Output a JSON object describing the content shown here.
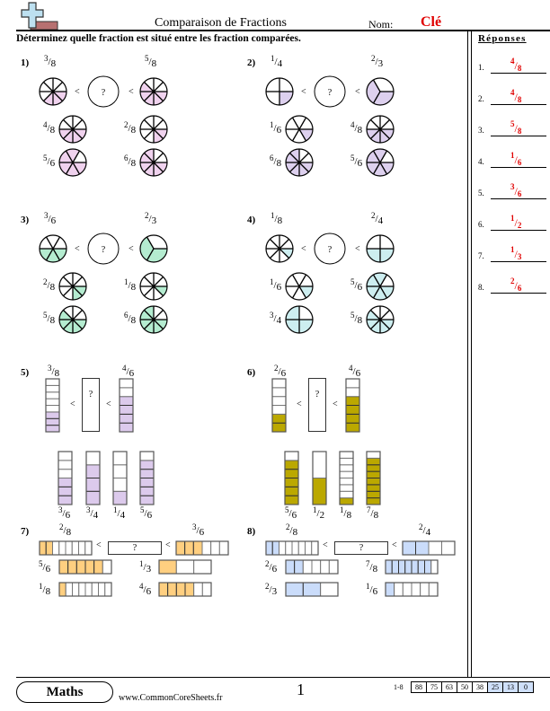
{
  "header": {
    "title": "Comparaison de Fractions",
    "name_label": "Nom:",
    "name_value": "Clé",
    "instructions": "Déterminez quelle fraction est situé entre les fraction comparées."
  },
  "answers": {
    "title": "Réponses",
    "items": [
      {
        "num": "1.",
        "n": "4",
        "d": "8"
      },
      {
        "num": "2.",
        "n": "4",
        "d": "8"
      },
      {
        "num": "3.",
        "n": "5",
        "d": "8"
      },
      {
        "num": "4.",
        "n": "1",
        "d": "6"
      },
      {
        "num": "5.",
        "n": "3",
        "d": "6"
      },
      {
        "num": "6.",
        "n": "1",
        "d": "2"
      },
      {
        "num": "7.",
        "n": "1",
        "d": "3"
      },
      {
        "num": "8.",
        "n": "2",
        "d": "6"
      }
    ]
  },
  "symbols": {
    "less_than": "<",
    "unknown": "?"
  },
  "problems": [
    {
      "label": "1)",
      "type": "circle",
      "color": "#f0d2ee",
      "left": [
        3,
        8
      ],
      "right": [
        5,
        8
      ],
      "options": [
        [
          4,
          8
        ],
        [
          2,
          8
        ],
        [
          5,
          6
        ],
        [
          6,
          8
        ]
      ]
    },
    {
      "label": "2)",
      "type": "circle",
      "color": "#ddd0ee",
      "left": [
        1,
        4
      ],
      "right": [
        2,
        3
      ],
      "options": [
        [
          1,
          6
        ],
        [
          4,
          8
        ],
        [
          6,
          8
        ],
        [
          5,
          6
        ]
      ]
    },
    {
      "label": "3)",
      "type": "circle",
      "color": "#b4ecd0",
      "left": [
        3,
        6
      ],
      "right": [
        2,
        3
      ],
      "options": [
        [
          2,
          8
        ],
        [
          1,
          8
        ],
        [
          5,
          8
        ],
        [
          6,
          8
        ]
      ]
    },
    {
      "label": "4)",
      "type": "circle",
      "color": "#cdeef0",
      "left": [
        1,
        8
      ],
      "right": [
        2,
        4
      ],
      "options": [
        [
          1,
          6
        ],
        [
          5,
          6
        ],
        [
          3,
          4
        ],
        [
          5,
          8
        ]
      ]
    },
    {
      "label": "5)",
      "type": "vbar",
      "color": "#dccaec",
      "left": [
        3,
        8
      ],
      "right": [
        4,
        6
      ],
      "options": [
        [
          3,
          6
        ],
        [
          3,
          4
        ],
        [
          1,
          4
        ],
        [
          5,
          6
        ]
      ]
    },
    {
      "label": "6)",
      "type": "vbar",
      "color": "#bba800",
      "left": [
        2,
        6
      ],
      "right": [
        4,
        6
      ],
      "options": [
        [
          5,
          6
        ],
        [
          1,
          2
        ],
        [
          1,
          8
        ],
        [
          7,
          8
        ]
      ]
    },
    {
      "label": "7)",
      "type": "hbar",
      "color": "#ffcf80",
      "left": [
        2,
        8
      ],
      "right": [
        3,
        6
      ],
      "options": [
        [
          5,
          6
        ],
        [
          1,
          3
        ],
        [
          1,
          8
        ],
        [
          4,
          6
        ]
      ]
    },
    {
      "label": "8)",
      "type": "hbar",
      "color": "#cadcfa",
      "left": [
        2,
        8
      ],
      "right": [
        2,
        4
      ],
      "options": [
        [
          2,
          6
        ],
        [
          7,
          8
        ],
        [
          2,
          3
        ],
        [
          1,
          6
        ]
      ]
    }
  ],
  "footer": {
    "badge": "Maths",
    "website": "www.CommonCoreSheets.fr",
    "page": "1",
    "score_label": "1-8",
    "scores": [
      "88",
      "75",
      "63",
      "50",
      "38",
      "25",
      "13",
      "0"
    ],
    "highlighted_scores": [
      "25",
      "13",
      "0"
    ]
  }
}
